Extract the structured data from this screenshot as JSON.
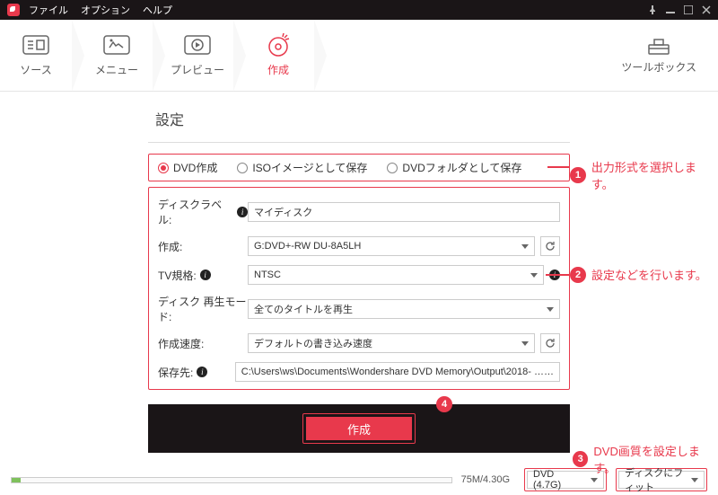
{
  "menubar": {
    "file": "ファイル",
    "option": "オプション",
    "help": "ヘルプ"
  },
  "tabs": {
    "source": "ソース",
    "menu": "メニュー",
    "preview": "プレビュー",
    "create": "作成",
    "toolbox": "ツールボックス"
  },
  "panel": {
    "title": "設定",
    "output_options": {
      "dvd": "DVD作成",
      "iso": "ISOイメージとして保存",
      "folder": "DVDフォルダとして保存"
    },
    "labels": {
      "disc_label": "ディスクラベル:",
      "create_to": "作成:",
      "tv_standard": "TV規格:",
      "play_mode": "ディスク 再生モード:",
      "speed": "作成速度:",
      "save_to": "保存先:"
    },
    "values": {
      "disc_label": "マイディスク",
      "create_to": "G:DVD+-RW DU-8A5LH",
      "tv_standard": "NTSC",
      "play_mode": "全てのタイトルを再生",
      "speed": "デフォルトの書き込み速度",
      "save_to": "C:\\Users\\ws\\Documents\\Wondershare DVD Memory\\Output\\2018- …"
    },
    "create_button": "作成"
  },
  "footer": {
    "size": "75M/4.30G",
    "dvd_capacity": "DVD (4.7G)",
    "fit_mode": "ディスクにフィット"
  },
  "callouts": {
    "c1": "出力形式を選択します。",
    "c2": "設定などを行います。",
    "c3": "DVD画質を設定します。",
    "c4": "4"
  }
}
